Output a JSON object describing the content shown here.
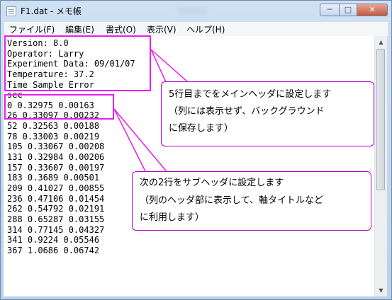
{
  "window": {
    "title": "F1.dat - メモ帳",
    "controls": {
      "minimize": "─",
      "maximize": "□",
      "close": "✕"
    }
  },
  "menu": [
    "ファイル(F)",
    "編集(E)",
    "書式(O)",
    "表示(V)",
    "ヘルプ(H)"
  ],
  "document": {
    "lines": [
      "Version: 8.0",
      "Operator: Larry",
      "Experiment Data: 09/01/07",
      "Temperature: 37.2",
      "Time Sample Error",
      "sec",
      "0 0.32975 0.00163",
      "26 0.33097 0.00232",
      "52 0.32563 0.00188",
      "78 0.33003 0.00219",
      "105 0.33067 0.00208",
      "131 0.32984 0.00206",
      "157 0.33607 0.00197",
      "183 0.3689 0.00501",
      "209 0.41027 0.00855",
      "236 0.47106 0.01454",
      "262 0.54792 0.02191",
      "288 0.65287 0.03155",
      "314 0.77145 0.04327",
      "341 0.9224 0.05546",
      "367 1.0686 0.06742"
    ]
  },
  "annotations": {
    "main_header": [
      "5行目までをメインヘッダに設定します",
      "（列には表示せず、バックグラウンド",
      "に保存します）"
    ],
    "sub_header": [
      "次の2行をサブヘッダに設定します",
      "（列のヘッダ部に表示して、軸タイトルなど",
      "に利用します）"
    ],
    "highlight_color": "#e81fe8"
  }
}
